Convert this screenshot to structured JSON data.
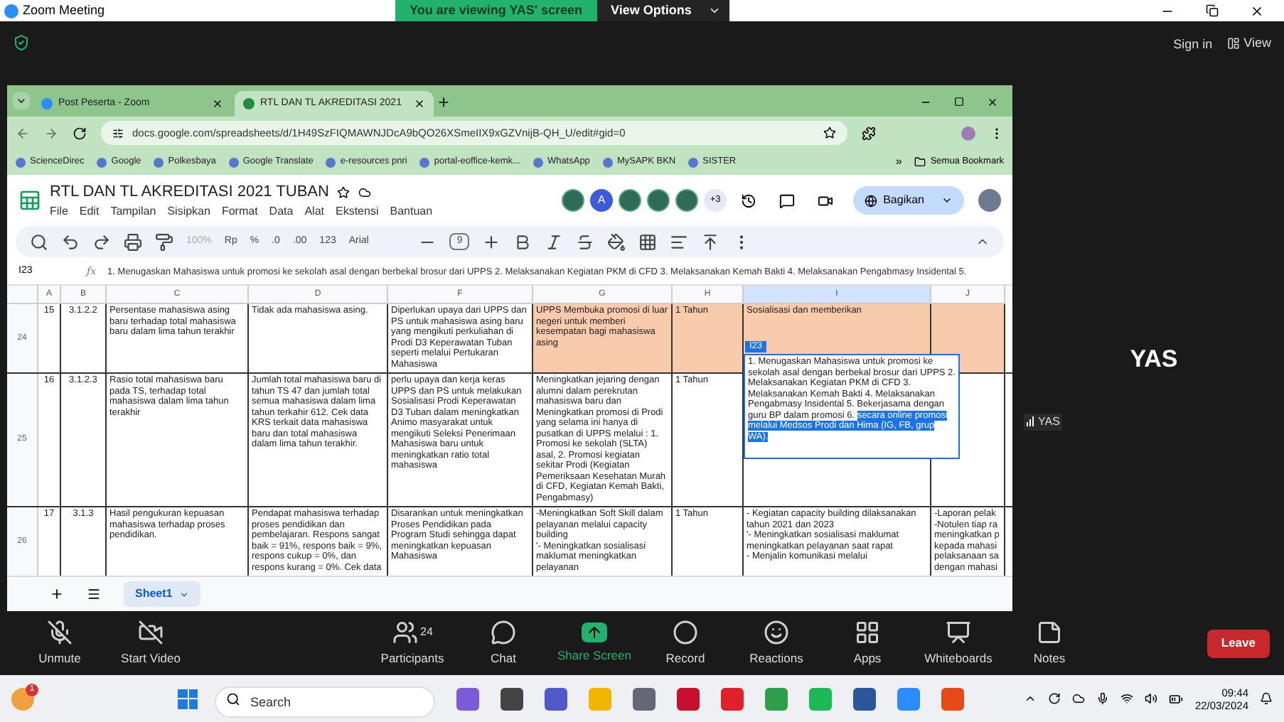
{
  "zoom_window": {
    "title": "Zoom Meeting",
    "banner": "You are viewing YAS' screen",
    "view_options": "View Options",
    "sign_in": "Sign in",
    "view": "View"
  },
  "browser": {
    "tabs": [
      {
        "label": "Post Peserta - Zoom",
        "selected": false
      },
      {
        "label": "RTL DAN TL AKREDITASI 2021",
        "selected": true
      }
    ],
    "url": "docs.google.com/spreadsheets/d/1H49SzFIQMAWNJDcA9bQO26XSmeIIX9xGZVnijB-QH_U/edit#gid=0",
    "bookmarks": [
      "ScienceDirec",
      "Google",
      "Polkesbaya",
      "Google Translate",
      "e-resources pnri",
      "portal-eoffice-kemk...",
      "WhatsApp",
      "MySAPK BKN",
      "SISTER"
    ],
    "more_bookmarks": "»",
    "all_bookmarks": "Semua Bookmark"
  },
  "sheet": {
    "title": "RTL DAN TL AKREDITASI 2021 TUBAN",
    "menu": [
      "File",
      "Edit",
      "Tampilan",
      "Sisipkan",
      "Format",
      "Data",
      "Alat",
      "Ekstensi",
      "Bantuan"
    ],
    "collaborators": [
      {
        "kind": "photo"
      },
      {
        "kind": "letter",
        "initial": "A"
      },
      {
        "kind": "photo"
      },
      {
        "kind": "photo"
      },
      {
        "kind": "photo"
      }
    ],
    "more_collaborators": "+3",
    "share": "Bagikan",
    "toolbar": {
      "zoom": "100%",
      "currency": "Rp",
      "percent": "%",
      "decrease_decimal": ".0",
      "increase_decimal": ".00",
      "number_format": "123",
      "font": "Arial",
      "font_size": "9"
    },
    "cell_ref": "I23",
    "formula_label": "ƒx",
    "formula": "1. Menugaskan Mahasiswa untuk promosi ke sekolah asal dengan berbekal brosur dari UPPS 2. Melaksanakan Kegiatan PKM di CFD 3. Melaksanakan Kemah Bakti 4. Melaksanakan Pengabmasy Insidental 5.",
    "columns": [
      {
        "label": "A",
        "selected": false
      },
      {
        "label": "B",
        "selected": false
      },
      {
        "label": "C",
        "selected": false
      },
      {
        "label": "D",
        "selected": false
      },
      {
        "label": "F",
        "selected": false
      },
      {
        "label": "G",
        "selected": false
      },
      {
        "label": "H",
        "selected": false
      },
      {
        "label": "I",
        "selected": true
      },
      {
        "label": "J",
        "selected": false
      }
    ],
    "rows": [
      {
        "number": "24",
        "cells": [
          {
            "text": "15",
            "highlighted": false
          },
          {
            "text": "3.1.2.2",
            "highlighted": false
          },
          {
            "text": "Persentase mahasiswa asing baru terhadap total mahasiswa baru dalam lima tahun terakhir",
            "highlighted": false
          },
          {
            "text": "Tidak ada mahasiswa asing.",
            "highlighted": false
          },
          {
            "text": "Diperlukan upaya dari UPPS dan PS untuk mahasiswa asing baru yang mengikuti perkuliahan di Prodi D3 Keperawatan Tuban seperti melalui Pertukaran Mahasiswa",
            "highlighted": false
          },
          {
            "text": "UPPS Membuka promosi di luar negeri untuk memberi kesempatan bagi mahasiswa asing",
            "highlighted": true
          },
          {
            "text": "1 Tahun",
            "highlighted": true
          },
          {
            "text": "Sosialisasi dan memberikan",
            "highlighted": true
          },
          {
            "text": "",
            "highlighted": true
          }
        ]
      },
      {
        "number": "25",
        "cells": [
          {
            "text": "16",
            "highlighted": false
          },
          {
            "text": "3.1.2.3",
            "highlighted": false
          },
          {
            "text": "Rasio total mahasiswa baru pada TS, terhadap total mahasiswa dalam lima tahun terakhir",
            "highlighted": false
          },
          {
            "text": "Jumlah total mahasiswa baru di tahun TS 47 dan jumlah total semua mahasiswa dalam lima tahun terkahir 612. Cek data KRS terkait data mahasiswa baru dan total mahasiswa dalam lima tahun terakhir.",
            "highlighted": false
          },
          {
            "text": "perlu upaya dan kerja keras UPPS dan PS untuk melakukan Sosialisasi Prodi Keperawatan D3 Tuban dalam meningkatkan Animo masyarakat untuk mengikuti Seleksi Penerimaan Mahasiswa baru untuk meningkatkan ratio total mahasiswa",
            "highlighted": false
          },
          {
            "text": "Meningkatkan jejaring dengan alumni dalam perekrutan mahasiswa baru dan Meningkatkan promosi di Prodi yang selama ini hanya di pusatkan di UPPS melalui : 1. Promosi ke sekolah (SLTA) asal, 2. Promosi kegiatan sekitar Prodi (Kegiatan Pemeriksaan Kesehatan Murah di CFD, Kegiatan Kemah Bakti, Pengabmasy)",
            "highlighted": false
          },
          {
            "text": "1 Tahun",
            "highlighted": false
          },
          {
            "text": "",
            "highlighted": false,
            "editing": true
          },
          {
            "text": "",
            "highlighted": false
          }
        ]
      },
      {
        "number": "26",
        "cells": [
          {
            "text": "17",
            "highlighted": false
          },
          {
            "text": "3.1.3",
            "highlighted": false
          },
          {
            "text": "Hasil pengukuran kepuasan mahasiswa terhadap proses pendidikan.",
            "highlighted": false
          },
          {
            "text": "Pendapat mahasiswa terhadap proses pendidikan dan pembelajaran. Respons sangat baik = 91%, respons baik = 9%, respons cukup = 0%, dan respons kurang = 0%. Cek data",
            "highlighted": false
          },
          {
            "text": "Disarankan untuk meningkatkan Proses Pendidikan pada Program Studi sehingga dapat meningkatkan kepuasan Mahasiswa",
            "highlighted": false
          },
          {
            "text": "-Meningkatkan Soft Skill dalam pelayanan melalui capacity building\n '- Meningkatkan sosialisasi maklumat meningkatkan pelayanan",
            "highlighted": false
          },
          {
            "text": "1 Tahun",
            "highlighted": false
          },
          {
            "text": "- Kegiatan capacity building dilaksanakan tahun 2021 dan 2023\n '- Meningkatkan sosialisasi maklumat meningkatkan pelayanan saat rapat\n - Menjalin komunikasi melalui",
            "highlighted": false
          },
          {
            "text": "-Laporan pelak\n-Notulen tiap ra\nmeningkatkan p\nkepada mahasi\npelaksanaan sa\ndengan mahasi",
            "highlighted": false
          }
        ]
      }
    ],
    "editor": {
      "tag": "I23",
      "text": "1. Menugaskan Mahasiswa untuk promosi ke sekolah asal dengan berbekal brosur dari UPPS 2. Melaksanakan Kegiatan PKM di CFD 3. Melaksanakan Kemah Bakti 4. Melaksanakan Pengabmasy Insidental 5. Bekerjasama dengan guru BP dalam promosi 6. ",
      "selected_text": "secara online promosi melalui Medsos Prodi dan Hima (IG, FB, grup WA)."
    },
    "sheet_tabs": [
      {
        "label": "Sheet1",
        "selected": true
      }
    ]
  },
  "presenter": {
    "name": "YAS",
    "label": "YAS"
  },
  "meeting_controls": [
    {
      "kind": "mic_off",
      "label": "Unmute"
    },
    {
      "kind": "video_off",
      "label": "Start Video"
    },
    {
      "kind": "participants",
      "label": "Participants",
      "count": "24"
    },
    {
      "kind": "chat",
      "label": "Chat"
    },
    {
      "kind": "share",
      "label": "Share Screen"
    },
    {
      "kind": "record",
      "label": "Record"
    },
    {
      "kind": "reactions",
      "label": "Reactions"
    },
    {
      "kind": "apps",
      "label": "Apps"
    },
    {
      "kind": "whiteboards",
      "label": "Whiteboards"
    },
    {
      "kind": "notes",
      "label": "Notes"
    }
  ],
  "leave": "Leave",
  "taskbar": {
    "weather_badge": "1",
    "search_placeholder": "Search",
    "time": "09:44",
    "date": "22/03/2024"
  }
}
